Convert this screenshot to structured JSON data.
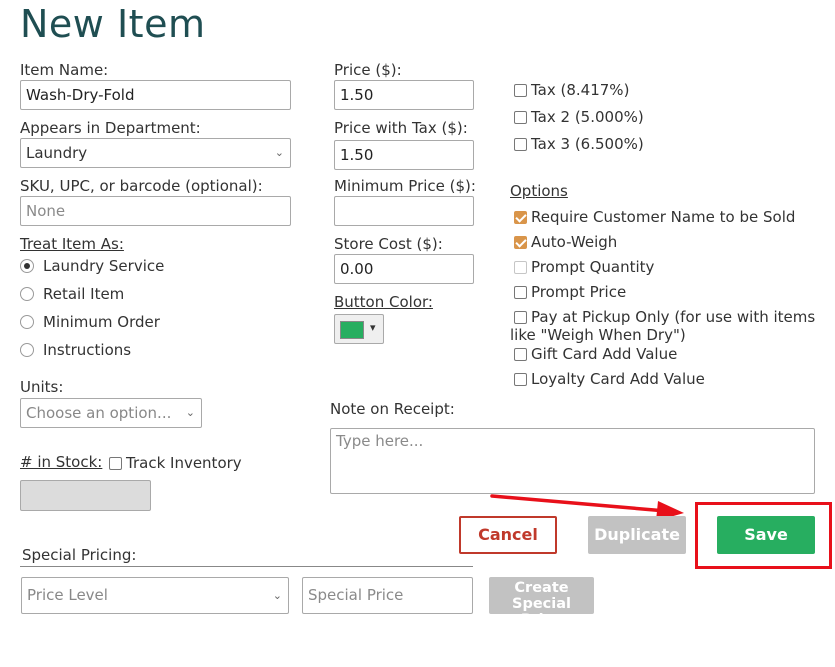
{
  "header": {
    "title": "New Item"
  },
  "item_name": {
    "label": "Item Name:",
    "value": "Wash-Dry-Fold"
  },
  "department": {
    "label": "Appears in Department:",
    "value": "Laundry"
  },
  "sku": {
    "label": "SKU, UPC, or barcode (optional):",
    "placeholder": "None"
  },
  "treat_as": {
    "label": "Treat Item As:",
    "options": [
      "Laundry Service",
      "Retail Item",
      "Minimum Order",
      "Instructions"
    ],
    "selected": "Laundry Service"
  },
  "units": {
    "label": "Units:",
    "placeholder": "Choose an option..."
  },
  "stock": {
    "label": "# in Stock:",
    "track_label": "Track Inventory"
  },
  "price": {
    "label": "Price ($):",
    "value": "1.50"
  },
  "price_tax": {
    "label": "Price with Tax ($):",
    "value": "1.50"
  },
  "min_price": {
    "label": "Minimum Price ($):",
    "value": ""
  },
  "store_cost": {
    "label": "Store Cost ($):",
    "value": "0.00"
  },
  "button_color": {
    "label": "Button Color:",
    "color": "#27ae60",
    "arrow": "▾"
  },
  "taxes": [
    "Tax (8.417%)",
    "Tax 2 (5.000%)",
    "Tax 3 (6.500%)"
  ],
  "options": {
    "label": "Options",
    "items": [
      {
        "label": "Require Customer Name to be Sold",
        "checked": true
      },
      {
        "label": "Auto-Weigh",
        "checked": true
      },
      {
        "label": "Prompt Quantity",
        "checked": false
      },
      {
        "label": "Prompt Price",
        "checked": false
      },
      {
        "label": "Pay at Pickup Only (for use with items",
        "label2": "like \"Weigh When Dry\")",
        "checked": false
      },
      {
        "label": "Gift Card Add Value",
        "checked": false
      },
      {
        "label": "Loyalty Card Add Value",
        "checked": false
      }
    ]
  },
  "note": {
    "label": "Note on Receipt:",
    "placeholder": "Type here..."
  },
  "actions": {
    "cancel": "Cancel",
    "duplicate": "Duplicate",
    "save": "Save"
  },
  "special_pricing": {
    "label": "Special Pricing:",
    "level_placeholder": "Price Level",
    "price_placeholder": "Special Price",
    "create_line1": "Create",
    "create_line2": "Special Price"
  },
  "colors": {
    "title": "#1f4e52",
    "save": "#27ae60",
    "cancel": "#c0392b",
    "annotation": "#e8101a",
    "checkbox_checked": "#d9954a"
  }
}
